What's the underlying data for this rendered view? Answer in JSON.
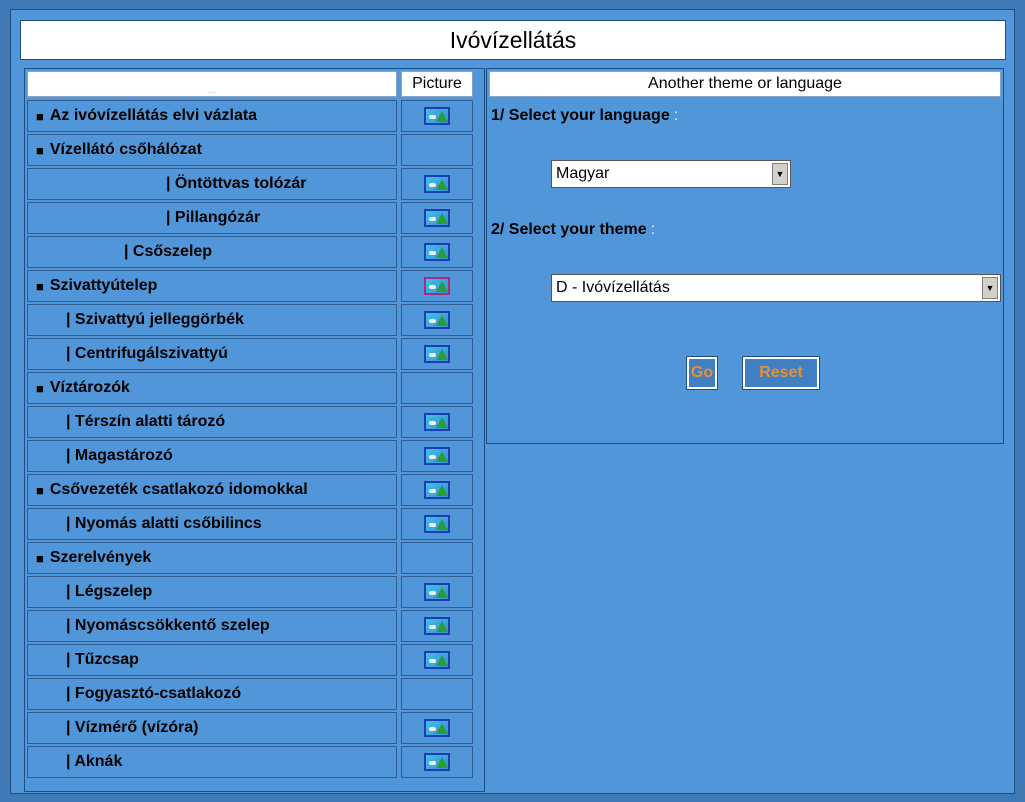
{
  "title": "Ivóvízellátás",
  "left_table": {
    "header_blank": "...",
    "header_picture": "Picture",
    "rows": [
      {
        "label": "Az ivóvízellátás elvi vázlata",
        "bullet": true,
        "indent": 0,
        "has_picture": true
      },
      {
        "label": "Vízellátó csőhálózat",
        "bullet": true,
        "indent": 0,
        "has_picture": false
      },
      {
        "label": "| Öntöttvas tolózár",
        "bullet": false,
        "indent": 3,
        "has_picture": true
      },
      {
        "label": "| Pillangózár",
        "bullet": false,
        "indent": 3,
        "has_picture": true
      },
      {
        "label": "| Csőszelep",
        "bullet": false,
        "indent": 2,
        "has_picture": true
      },
      {
        "label": "Szivattyútelep",
        "bullet": true,
        "indent": 0,
        "has_picture": true
      },
      {
        "label": "| Szivattyú jelleggörbék",
        "bullet": false,
        "indent": 1,
        "has_picture": true
      },
      {
        "label": "| Centrifugálszivattyú",
        "bullet": false,
        "indent": 1,
        "has_picture": true
      },
      {
        "label": "Víztározók",
        "bullet": true,
        "indent": 0,
        "has_picture": false
      },
      {
        "label": "| Térszín alatti tározó",
        "bullet": false,
        "indent": 1,
        "has_picture": true
      },
      {
        "label": "| Magastározó",
        "bullet": false,
        "indent": 1,
        "has_picture": true
      },
      {
        "label": "Csővezeték csatlakozó idomokkal",
        "bullet": true,
        "indent": 0,
        "has_picture": true
      },
      {
        "label": "| Nyomás alatti csőbilincs",
        "bullet": false,
        "indent": 1,
        "has_picture": true
      },
      {
        "label": "Szerelvények",
        "bullet": true,
        "indent": 0,
        "has_picture": false
      },
      {
        "label": "| Légszelep",
        "bullet": false,
        "indent": 1,
        "has_picture": true
      },
      {
        "label": "| Nyomáscsökkentő szelep",
        "bullet": false,
        "indent": 1,
        "has_picture": true
      },
      {
        "label": "| Tűzcsap",
        "bullet": false,
        "indent": 1,
        "has_picture": true
      },
      {
        "label": "| Fogyasztó-csatlakozó",
        "bullet": false,
        "indent": 1,
        "has_picture": false
      },
      {
        "label": "| Vízmérő (vízóra)",
        "bullet": false,
        "indent": 1,
        "has_picture": true
      },
      {
        "label": "| Aknák",
        "bullet": false,
        "indent": 1,
        "has_picture": true
      }
    ]
  },
  "right_panel": {
    "header": "Another theme or language",
    "language_label": "1/ Select your language",
    "language_colon": ":",
    "language_value": "Magyar",
    "theme_label": "2/ Select your theme",
    "theme_colon": ":",
    "theme_value": "D - Ivóvízellátás",
    "go_label": "Go",
    "reset_label": "Reset"
  },
  "icons": {
    "bullet": "black-square-bullet-icon",
    "picture": "picture-thumbnail-icon",
    "dropdown": "chevron-down-icon"
  },
  "colors": {
    "background": "#3f79b6",
    "panel": "#5096d8",
    "button_text": "#e8902c"
  }
}
